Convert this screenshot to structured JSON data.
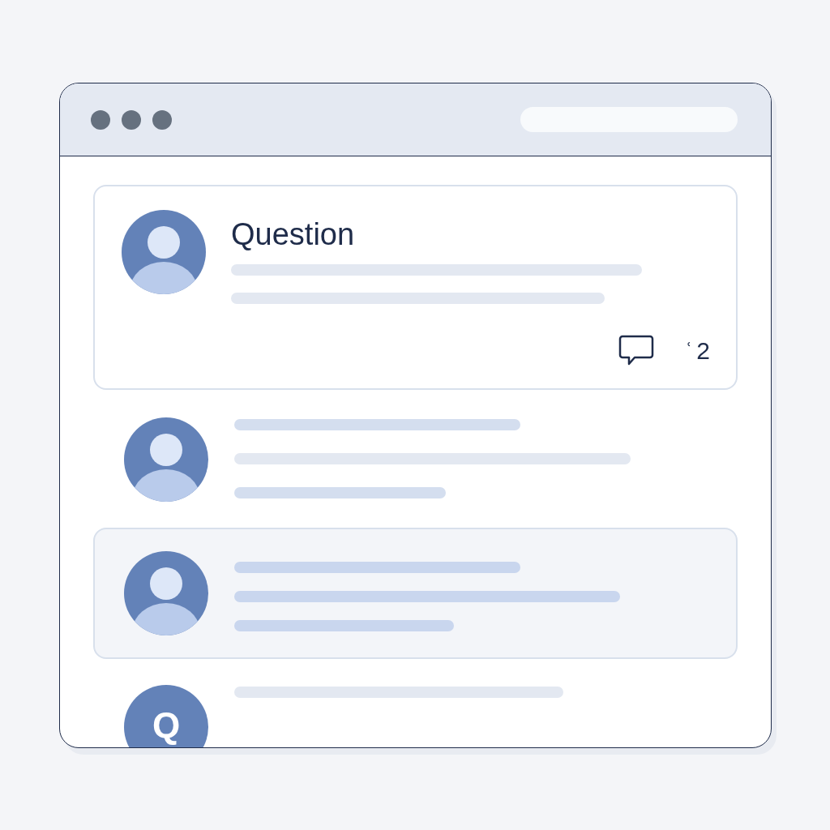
{
  "posts": [
    {
      "kind": "question",
      "title": "Question",
      "comment_mark": "ʿ",
      "comment_count": "2"
    },
    {
      "kind": "answer",
      "selected": false
    },
    {
      "kind": "answer",
      "selected": true
    },
    {
      "kind": "answer",
      "selected": false,
      "avatar_letter": "Q"
    }
  ]
}
